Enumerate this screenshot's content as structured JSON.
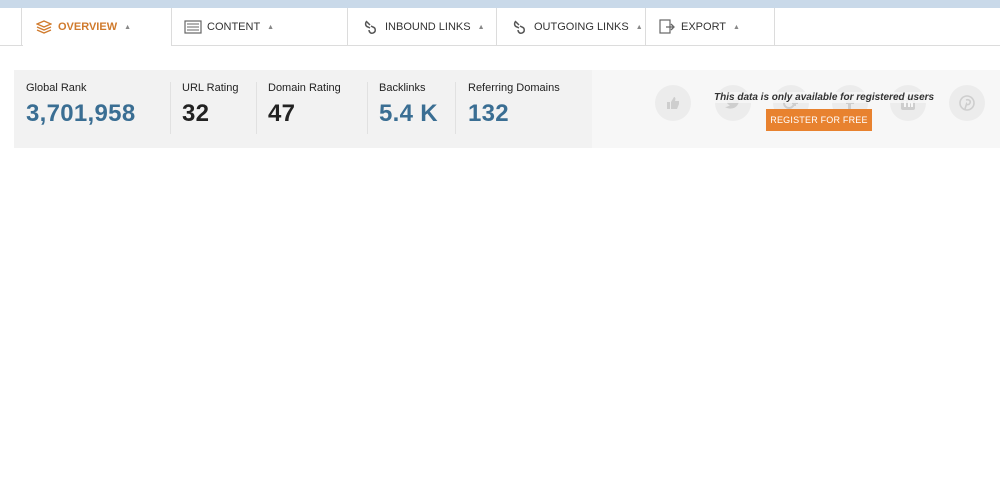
{
  "tabs": [
    {
      "label": "OVERVIEW",
      "icon": "layers-icon",
      "active": true
    },
    {
      "label": "CONTENT",
      "icon": "document-list-icon",
      "active": false
    },
    {
      "label": "INBOUND LINKS",
      "icon": "link-icon",
      "active": false
    },
    {
      "label": "OUTGOING LINKS",
      "icon": "link-icon",
      "active": false
    },
    {
      "label": "EXPORT",
      "icon": "export-icon",
      "active": false
    }
  ],
  "stats": [
    {
      "label": "Global Rank",
      "value": "3,701,958",
      "color": "#3a6e93"
    },
    {
      "label": "URL Rating",
      "value": "32",
      "color": "#222222"
    },
    {
      "label": "Domain Rating",
      "value": "47",
      "color": "#222222"
    },
    {
      "label": "Backlinks",
      "value": "5.4 K",
      "color": "#3a6e93"
    },
    {
      "label": "Referring Domains",
      "value": "132",
      "color": "#3a6e93"
    }
  ],
  "social": [
    "thumbs-up-icon",
    "twitter-icon",
    "google-plus-icon",
    "facebook-icon",
    "linkedin-icon",
    "pinterest-icon"
  ],
  "notice": "This data is only available for registered users",
  "register_button": "REGISTER FOR FREE",
  "colors": {
    "accent": "#e8822f",
    "active_tab": "#d07a2c",
    "link_value": "#3a6e93"
  }
}
